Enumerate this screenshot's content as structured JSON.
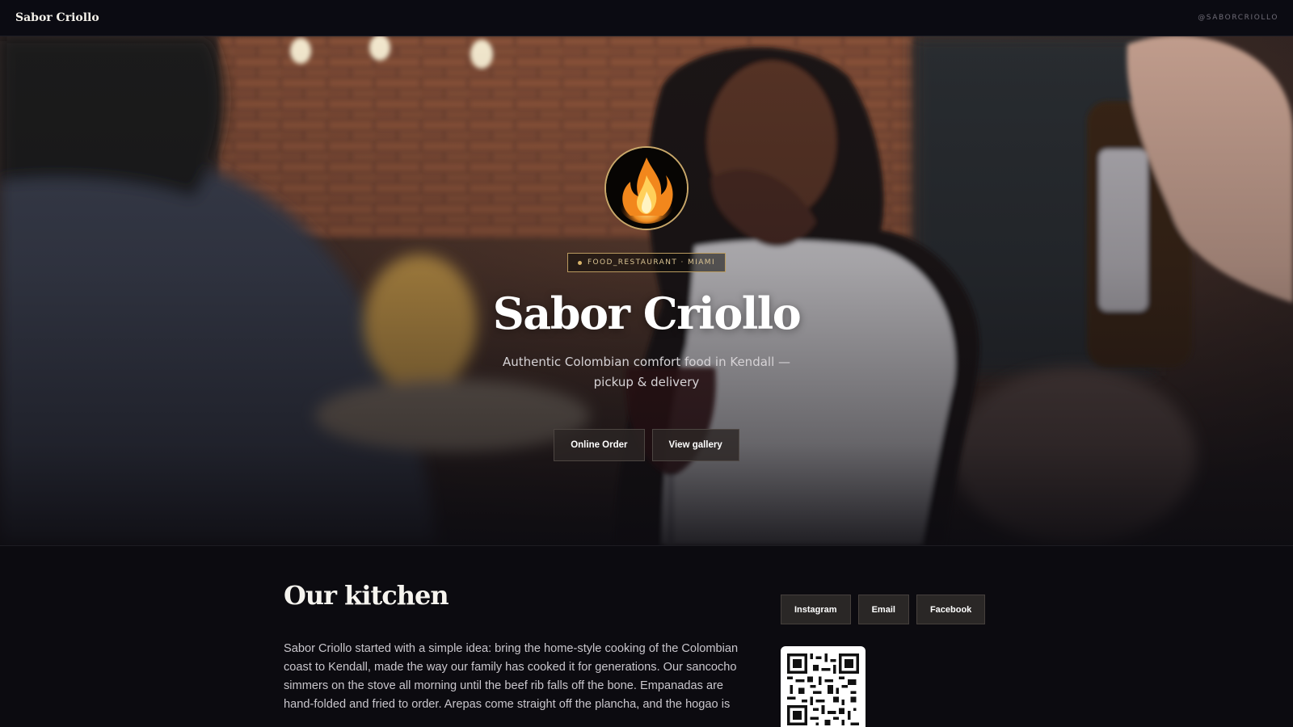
{
  "topbar": {
    "brand": "Sabor Criollo",
    "handle": "@SABORCRIOLLO"
  },
  "hero": {
    "badge": "FOOD_RESTAURANT · MIAMI",
    "title": "Sabor Criollo",
    "subtitle": "Authentic Colombian comfort food in Kendall — pickup & delivery",
    "primary_button": "Online Order",
    "secondary_button": "View gallery"
  },
  "about": {
    "title": "Our kitchen",
    "body": "Sabor Criollo started with a simple idea: bring the home-style cooking of the Colombian coast to Kendall, made the way our family has cooked it for generations. Our sancocho simmers on the stove all morning until the beef rib falls off the bone. Empanadas are hand-folded and fried to order. Arepas come straight off the plancha, and the hogao is"
  },
  "social": {
    "instagram": "Instagram",
    "email": "Email",
    "facebook": "Facebook"
  },
  "colors": {
    "accent_gold": "#c9a86a",
    "page_background": "#0c0b10",
    "button_background": "#2a2726"
  },
  "icons": {
    "avatar": "flame-logo-icon",
    "badge": "dot-icon",
    "qr": "qr-code-icon"
  }
}
